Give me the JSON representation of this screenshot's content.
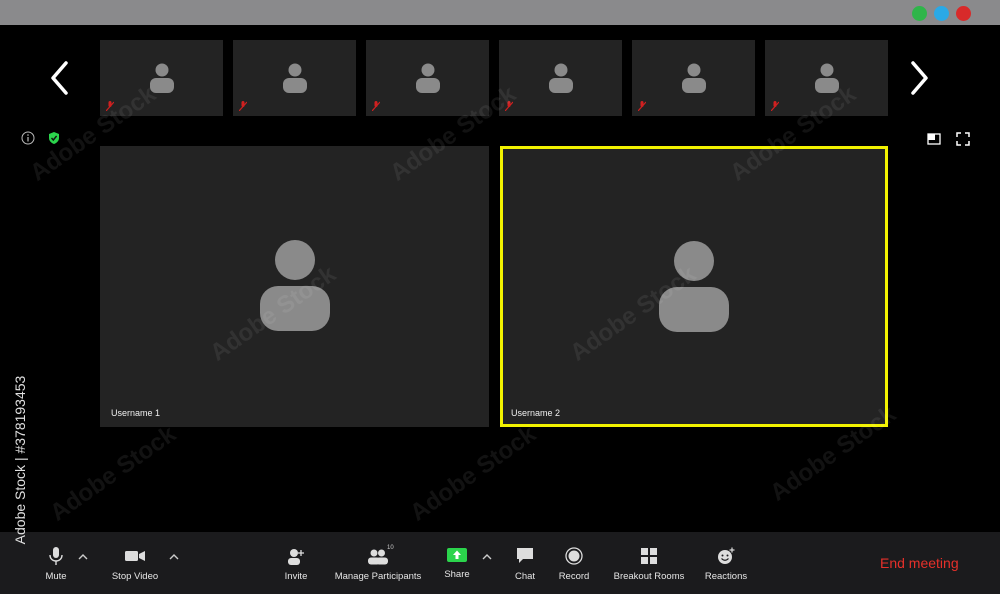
{
  "window": {
    "controls": [
      {
        "name": "green",
        "color": "#2fb54a"
      },
      {
        "name": "blue",
        "color": "#2aa9e6"
      },
      {
        "name": "red",
        "color": "#d82a2a"
      }
    ]
  },
  "gallery": {
    "prev_icon": "chevron-left-icon",
    "next_icon": "chevron-right-icon",
    "thumbnail_count": 6
  },
  "info": {
    "info_icon": "info-icon",
    "encryption_icon": "shield-check-icon"
  },
  "view": {
    "speaker_icon": "speaker-view-icon",
    "fullscreen_icon": "fullscreen-icon"
  },
  "participants": [
    {
      "name": "Username 1",
      "active_speaker": false
    },
    {
      "name": "Username 2",
      "active_speaker": true
    }
  ],
  "active_speaker_color": "#f2f200",
  "toolbar": {
    "mute": "Mute",
    "stop_video": "Stop Video",
    "invite": "Invite",
    "manage_participants": "Manage Participants",
    "participant_count": "10",
    "share": "Share",
    "chat": "Chat",
    "record": "Record",
    "breakout_rooms": "Breakout Rooms",
    "reactions": "Reactions",
    "end_meeting": "End meeting"
  },
  "share_color": "#2bd44c",
  "end_meeting_color": "#e6302a",
  "watermark": {
    "brand": "Adobe Stock",
    "side_text": "Adobe Stock | #378193453"
  }
}
